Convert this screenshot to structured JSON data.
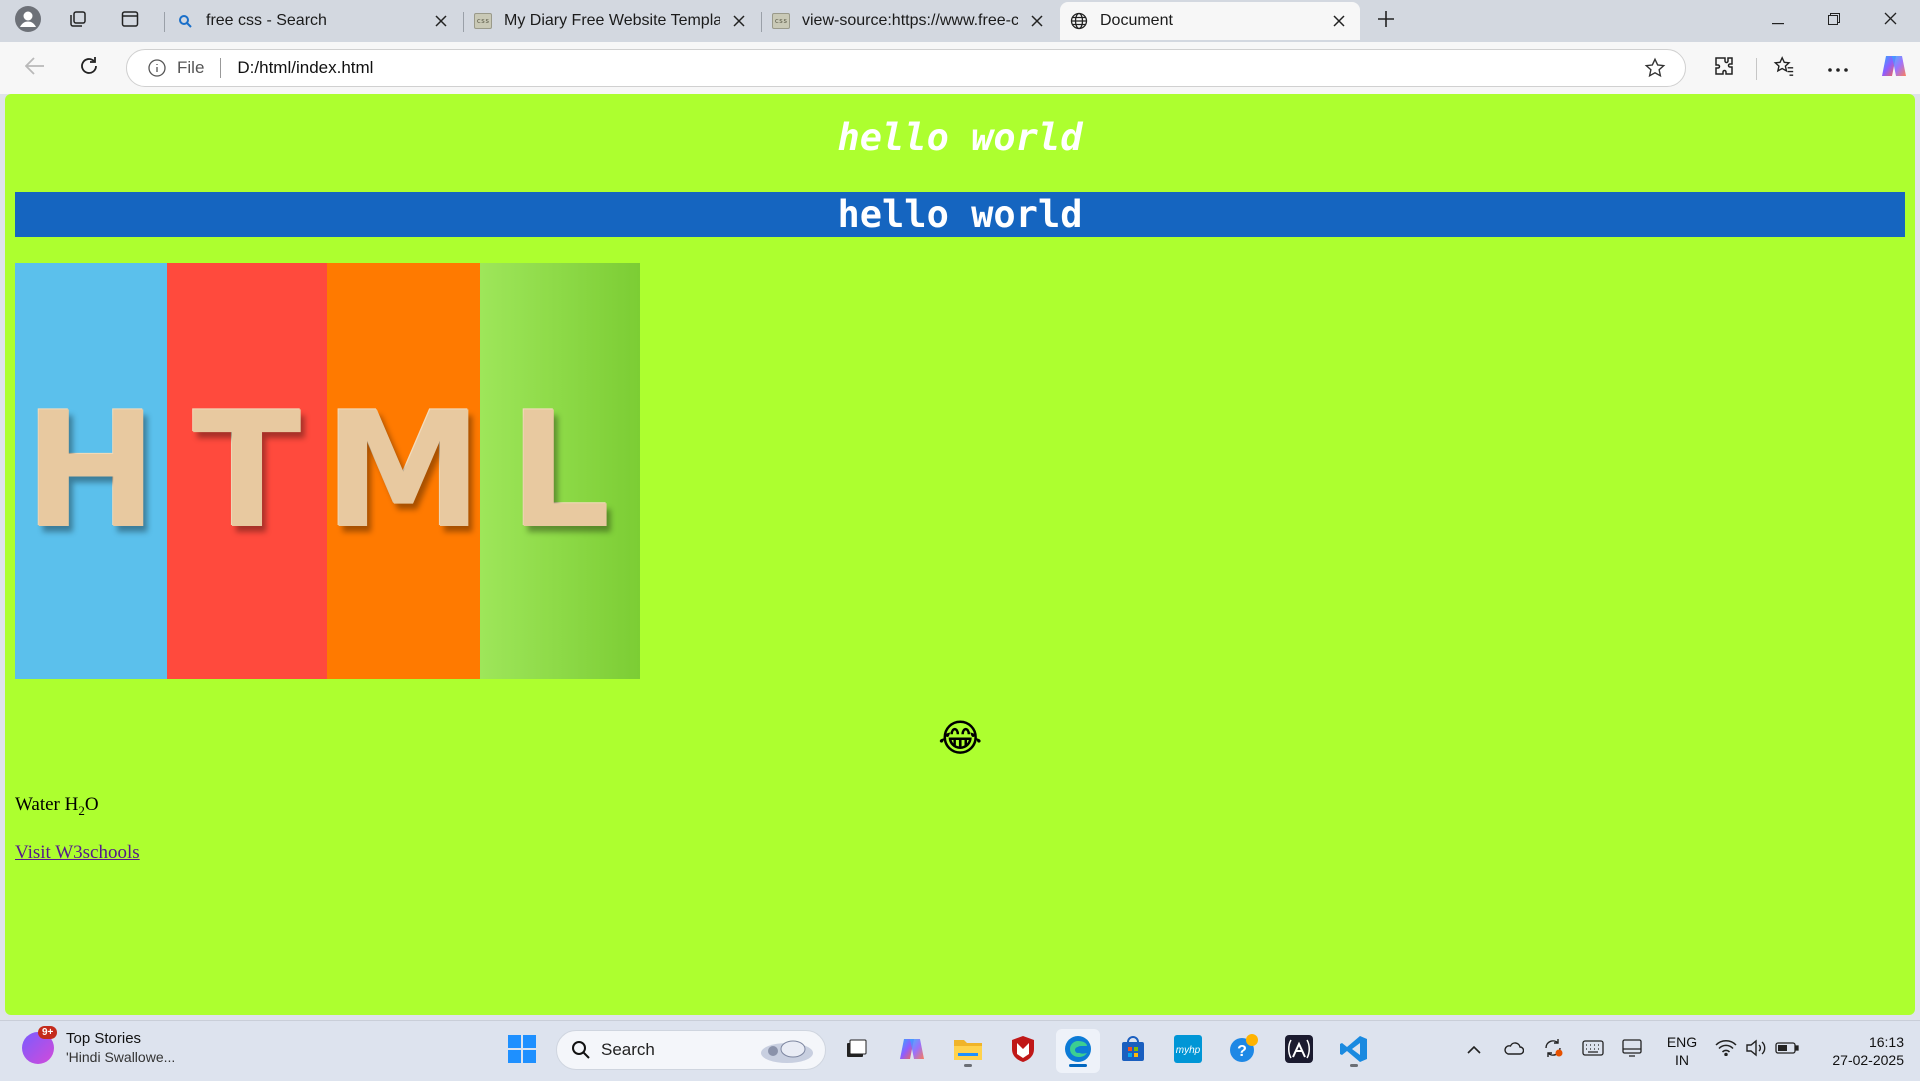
{
  "browser": {
    "tabs": [
      {
        "title": "free css - Search",
        "favicon": "search-icon",
        "active": false
      },
      {
        "title": "My Diary Free Website Template | ",
        "favicon": "css-file-icon",
        "active": false
      },
      {
        "title": "view-source:https://www.free-css.",
        "favicon": "css-file-icon",
        "active": false
      },
      {
        "title": "Document",
        "favicon": "globe-icon",
        "active": true
      }
    ],
    "address": {
      "scheme": "File",
      "url": "D:/html/index.html"
    }
  },
  "page": {
    "background": "#adff2f",
    "heading_italic": "hello world",
    "heading_banner": "hello world",
    "banner_color": "#1565c0",
    "image_letters": [
      "H",
      "T",
      "M",
      "L"
    ],
    "image_stripe_colors": [
      "#5bc0ec",
      "#ff4a3d",
      "#ff7a00",
      "#8fd43a"
    ],
    "emoji": "😂",
    "water_prefix": "Water H",
    "water_sub": "2",
    "water_suffix": "O",
    "link_text": "Visit W3schools"
  },
  "taskbar": {
    "news_title": "Top Stories",
    "news_sub": "'Hindi Swallowe...",
    "news_badge": "9+",
    "search_label": "Search",
    "lang_top": "ENG",
    "lang_bottom": "IN",
    "time": "16:13",
    "date": "27-02-2025"
  }
}
